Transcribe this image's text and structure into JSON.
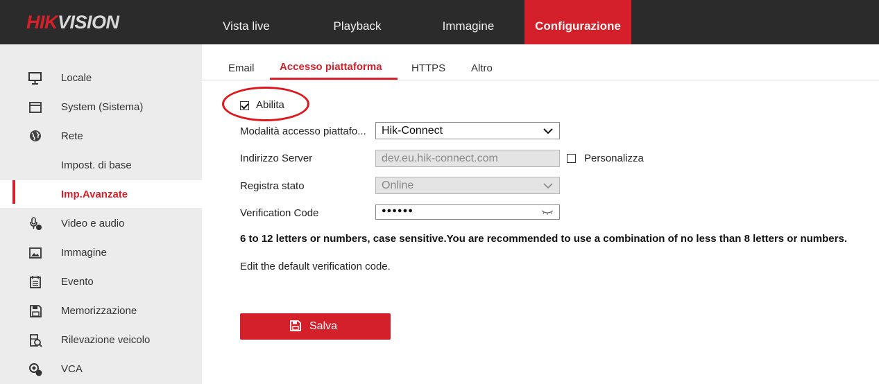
{
  "brand": {
    "hik": "HIK",
    "vision": "VISION"
  },
  "topnav": {
    "items": [
      {
        "label": "Vista live"
      },
      {
        "label": "Playback"
      },
      {
        "label": "Immagine"
      },
      {
        "label": "Configurazione"
      }
    ],
    "active_color": "#d4202a"
  },
  "sidebar": {
    "items": [
      {
        "label": "Locale",
        "icon": "monitor-icon"
      },
      {
        "label": "System (Sistema)",
        "icon": "window-icon"
      },
      {
        "label": "Rete",
        "icon": "globe-icon"
      },
      {
        "label": "Impost. di base"
      },
      {
        "label": "Imp.Avanzate"
      },
      {
        "label": "Video e audio",
        "icon": "camera-mic-icon"
      },
      {
        "label": "Immagine",
        "icon": "image-icon"
      },
      {
        "label": "Evento",
        "icon": "calendar-icon"
      },
      {
        "label": "Memorizzazione",
        "icon": "save-disk-icon"
      },
      {
        "label": "Rilevazione veicolo",
        "icon": "vehicle-search-icon"
      },
      {
        "label": "VCA",
        "icon": "vca-icon"
      }
    ]
  },
  "tabs": [
    {
      "label": "Email"
    },
    {
      "label": "Accesso piattaforma"
    },
    {
      "label": "HTTPS"
    },
    {
      "label": "Altro"
    }
  ],
  "form": {
    "enable_label": "Abilita",
    "enable_checked": true,
    "mode_label": "Modalità accesso piattafo...",
    "mode_value": "Hik-Connect",
    "server_label": "Indirizzo Server",
    "server_value": "dev.eu.hik-connect.com",
    "custom_label": "Personalizza",
    "status_label": "Registra stato",
    "status_value": "Online",
    "code_label": "Verification Code",
    "code_value": "●●●●●●",
    "hint_bold": "6 to 12 letters or numbers, case sensitive.You are recommended to use a combination of no less than 8 letters or numbers.",
    "hint": "Edit the default verification code.",
    "save_label": "Salva"
  }
}
